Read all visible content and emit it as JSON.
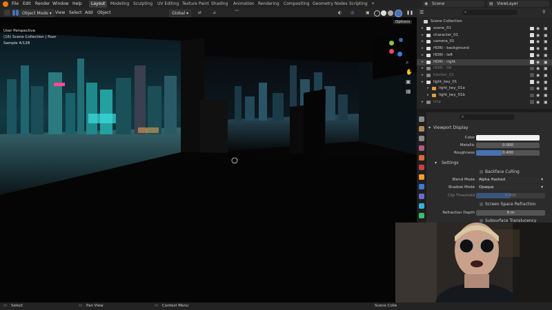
{
  "menu": [
    "File",
    "Edit",
    "Render",
    "Window",
    "Help"
  ],
  "workspaces": [
    {
      "label": "Layout",
      "active": true
    },
    {
      "label": "Modeling",
      "active": false
    },
    {
      "label": "Sculpting",
      "active": false
    },
    {
      "label": "UV Editing",
      "active": false
    },
    {
      "label": "Texture Paint",
      "active": false
    },
    {
      "label": "Shading",
      "active": false
    },
    {
      "label": "Animation",
      "active": false
    },
    {
      "label": "Rendering",
      "active": false
    },
    {
      "label": "Compositing",
      "active": false
    },
    {
      "label": "Geometry Nodes",
      "active": false
    },
    {
      "label": "Scripting",
      "active": false
    }
  ],
  "add_workspace": "+",
  "scene": {
    "label": "Scene",
    "view_layer": "ViewLayer"
  },
  "viewport_header": {
    "mode": "Object Mode",
    "menus": [
      "View",
      "Select",
      "Add",
      "Object"
    ],
    "transform": "Global",
    "options": "Options"
  },
  "viewport": {
    "perspective": "User Perspective",
    "collection": "(16) Scene Collection | floor",
    "sample": "Sample 4/128"
  },
  "outliner": {
    "root": "Scene Collection",
    "items": [
      {
        "label": "scene_01",
        "icon_color": "#e0e0e0",
        "dim": false,
        "checked": true,
        "selected": false
      },
      {
        "label": "character_01",
        "icon_color": "#e0e0e0",
        "dim": false,
        "checked": true,
        "selected": false
      },
      {
        "label": "camera_01",
        "icon_color": "#e0e0e0",
        "dim": false,
        "checked": true,
        "selected": false
      },
      {
        "label": "HDRI - background",
        "icon_color": "#e0e0e0",
        "dim": false,
        "checked": true,
        "selected": false
      },
      {
        "label": "HDRI - left",
        "icon_color": "#e0e0e0",
        "dim": false,
        "checked": true,
        "selected": false
      },
      {
        "label": "HDRI - right",
        "icon_color": "#e0e0e0",
        "dim": false,
        "checked": true,
        "selected": true
      },
      {
        "label": "HDRI - 08",
        "icon_color": "#888888",
        "dim": true,
        "checked": false,
        "selected": false
      },
      {
        "label": "blocker_01",
        "icon_color": "#888888",
        "dim": true,
        "checked": false,
        "selected": false
      },
      {
        "label": "light_key_01",
        "icon_color": "#e0e0e0",
        "dim": false,
        "checked": true,
        "selected": false
      },
      {
        "label": "light_key_01a",
        "icon_color": "#e0a040",
        "dim": false,
        "checked": false,
        "selected": false
      },
      {
        "label": "light_key_01b",
        "icon_color": "#e0a040",
        "dim": false,
        "checked": false,
        "selected": false
      },
      {
        "label": "tmp",
        "icon_color": "#888888",
        "dim": true,
        "checked": false,
        "selected": false
      }
    ]
  },
  "properties": {
    "panel": "Viewport Display",
    "color_label": "Color",
    "metallic_label": "Metallic",
    "metallic": "0.000",
    "roughness_label": "Roughness",
    "roughness": "0.400",
    "settings": "Settings",
    "backface": "Backface Culling",
    "blend_label": "Blend Mode",
    "blend": "Alpha Hashed",
    "shadow_label": "Shadow Mode",
    "shadow": "Opaque",
    "clip_label": "Clip Threshold",
    "clip": "0.500",
    "ssr": "Screen Space Refraction",
    "refr_label": "Refraction Depth",
    "refr": "0 m",
    "sss": "Subsurface Translucency"
  },
  "statusbar": {
    "select": "Select",
    "pan": "Pan View",
    "context": "Context Menu",
    "scene": "Scene Colle"
  }
}
